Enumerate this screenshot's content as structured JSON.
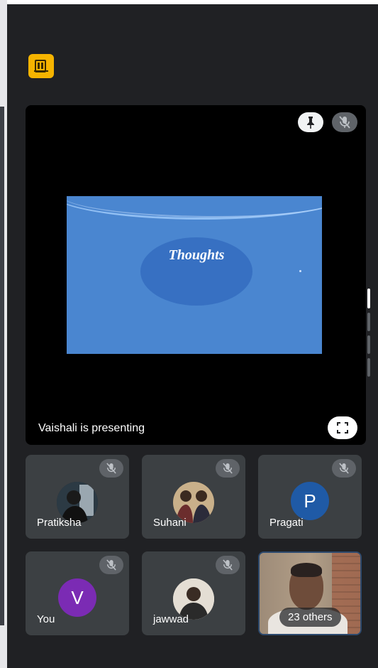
{
  "meeting": {
    "badge_icon": "meeting-code-icon",
    "accent_color": "#f6b400"
  },
  "presentation": {
    "presenting_text": "Vaishali is presenting",
    "slide_title": "Thoughts",
    "slide_bg_color": "#4a86d0",
    "buttons": [
      "pin-icon",
      "mic-off-icon",
      "fullscreen-icon"
    ]
  },
  "participants": [
    {
      "name": "Pratiksha",
      "muted": true,
      "avatar": "photo"
    },
    {
      "name": "Suhani",
      "muted": true,
      "avatar": "photo"
    },
    {
      "name": "Pragati",
      "muted": true,
      "avatar": "letter",
      "initial": "P",
      "color": "#1f5aa6"
    },
    {
      "name": "You",
      "muted": true,
      "avatar": "letter",
      "initial": "V",
      "color": "#7b2bb4"
    },
    {
      "name": "jawwad",
      "muted": true,
      "avatar": "photo"
    },
    {
      "name": "",
      "muted": false,
      "avatar": "video",
      "overlay": "23 others"
    }
  ]
}
